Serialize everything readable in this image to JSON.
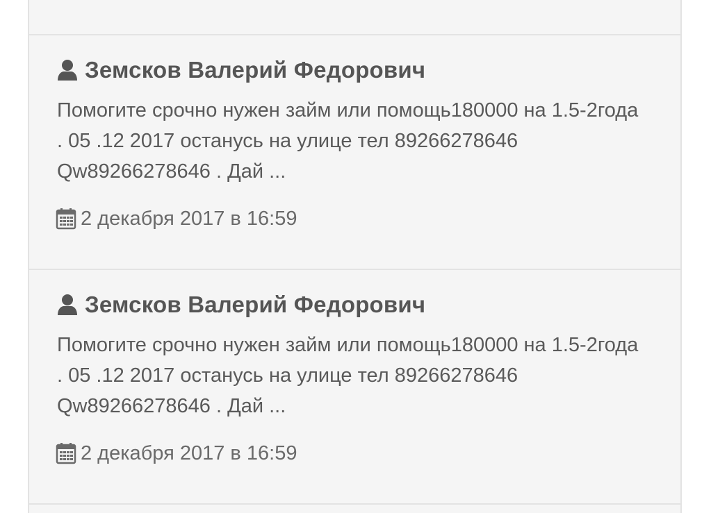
{
  "colors": {
    "background": "#f5f5f5",
    "divider": "#e3e3e3",
    "author_text": "#555555",
    "body_text": "#5a5a5a",
    "meta_text": "#6a6a6a",
    "icon": "#555555"
  },
  "posts": [
    {
      "author": "Земсков Валерий Федорович",
      "author_icon": "user-icon",
      "message": "Помогите срочно нужен займ или помощь180000 на 1.5-2года . 05 .12 2017 останусь на улице тел 89266278646 Qw89266278646 . Дай ...",
      "date_icon": "calendar-icon",
      "date": "2 декабря 2017 в 16:59"
    },
    {
      "author": "Земсков Валерий Федорович",
      "author_icon": "user-icon",
      "message": "Помогите срочно нужен займ или помощь180000 на 1.5-2года . 05 .12 2017 останусь на улице тел 89266278646 Qw89266278646 . Дай ...",
      "date_icon": "calendar-icon",
      "date": "2 декабря 2017 в 16:59"
    }
  ]
}
